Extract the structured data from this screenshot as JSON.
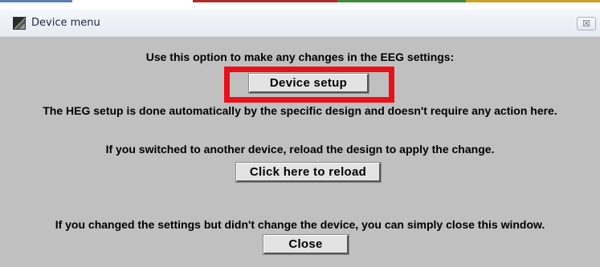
{
  "window": {
    "title": "Device menu",
    "close_glyph": "☒",
    "icon": "app-icon"
  },
  "content": {
    "line1": "Use this option to make any changes in the EEG settings:",
    "device_setup_label": "Device setup",
    "line2": "The HEG setup is done automatically by the specific design and doesn't require any action here.",
    "line3": "If you switched to another device, reload the design to apply the change.",
    "reload_label": "Click here to reload",
    "line4": "If you changed the settings but didn't change the device, you can simply close this window.",
    "close_label": "Close"
  },
  "colors": {
    "panel_background": "#c0c0c0",
    "highlight": "#e8111a",
    "button_face": "#e3e3e3"
  }
}
